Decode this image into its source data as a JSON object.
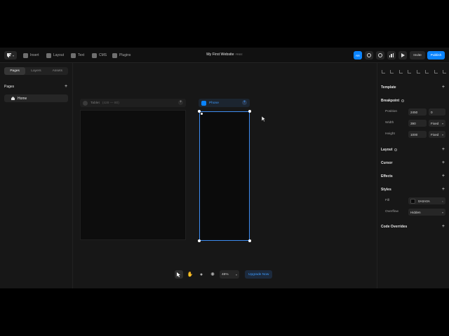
{
  "toolbar": {
    "insert": "Insert",
    "layout": "Layout",
    "text": "Text",
    "cms": "CMS",
    "plugins": "Plugins"
  },
  "project": {
    "title": "My First Website",
    "badge": "FREE"
  },
  "header_right": {
    "avatar_label": "RR",
    "invite": "Invite",
    "publish": "Publish"
  },
  "left_panel": {
    "tabs": [
      "Pages",
      "Layers",
      "Assets"
    ],
    "section_title": "Pages",
    "pages": [
      "Home"
    ]
  },
  "canvas": {
    "tablet": {
      "label": "Tablet",
      "range": "(428 — 80)"
    },
    "phone": {
      "label": "Phone"
    }
  },
  "bottom_toolbar": {
    "zoom": "46%",
    "upgrade": "Upgrade Now"
  },
  "right_panel": {
    "template": "Template",
    "breakpoint": "Breakpoint",
    "position_label": "Position",
    "position_x": "2450",
    "position_y": "0",
    "width_label": "Width",
    "width_value": "390",
    "width_mode": "Fixed",
    "height_label": "Height",
    "height_value": "1000",
    "height_mode": "Fixed",
    "layout": "Layout",
    "cursor": "Cursor",
    "effects": "Effects",
    "styles": "Styles",
    "fill_label": "Fill",
    "fill_value": "0A0A0A",
    "overflow_label": "Overflow",
    "overflow_value": "Hidden",
    "code_overrides": "Code Overrides"
  },
  "colors": {
    "accent": "#0a84ff",
    "background": "#171717",
    "fill_swatch": "#0a0a0a"
  },
  "icons": [
    "framer-logo-icon",
    "insert-icon",
    "layout-icon",
    "text-icon",
    "cms-icon",
    "plugins-icon",
    "globe-icon",
    "settings-icon",
    "analytics-icon",
    "play-icon",
    "home-icon",
    "pointer-icon",
    "hand-icon",
    "comment-icon",
    "sun-icon"
  ]
}
